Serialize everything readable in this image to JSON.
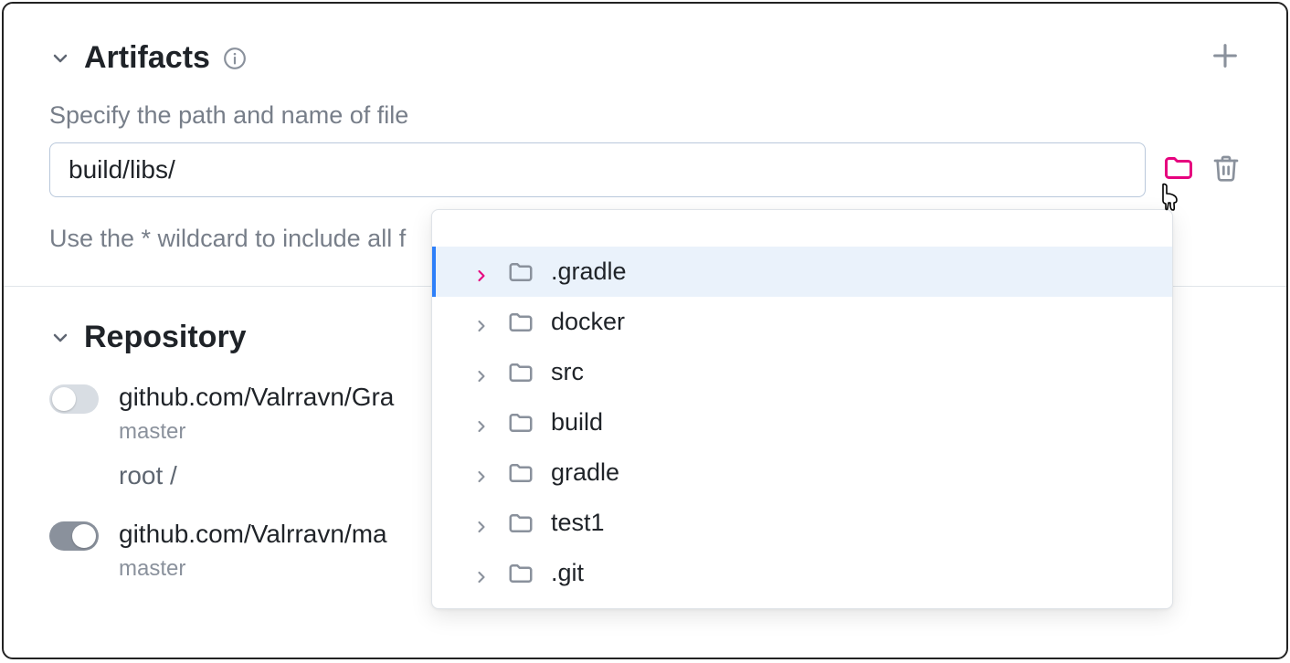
{
  "artifacts": {
    "title": "Artifacts",
    "field_label": "Specify the path and name of file",
    "input_value": "build/libs/",
    "hint": "Use the * wildcard to include all f"
  },
  "tree": {
    "items": [
      {
        "label": ".gradle",
        "selected": true
      },
      {
        "label": "docker",
        "selected": false
      },
      {
        "label": "src",
        "selected": false
      },
      {
        "label": "build",
        "selected": false
      },
      {
        "label": "gradle",
        "selected": false
      },
      {
        "label": "test1",
        "selected": false
      },
      {
        "label": ".git",
        "selected": false
      }
    ]
  },
  "repository": {
    "title": "Repository",
    "items": [
      {
        "enabled": false,
        "url": "github.com/Valrravn/Gra",
        "branch": "master",
        "root": "root /"
      },
      {
        "enabled": true,
        "url": "github.com/Valrravn/ma",
        "branch": "master",
        "root": ""
      }
    ]
  }
}
